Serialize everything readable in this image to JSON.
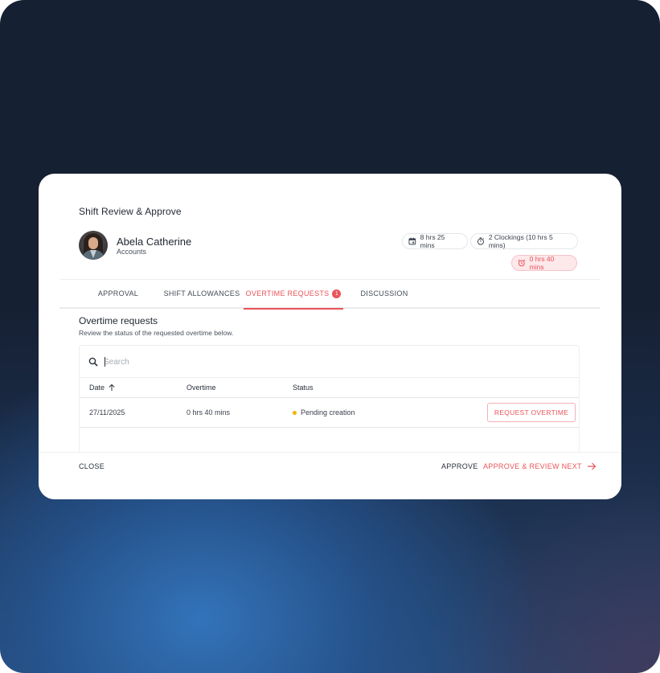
{
  "modal": {
    "title": "Shift Review & Approve"
  },
  "employee": {
    "name": "Abela Catherine",
    "department": "Accounts"
  },
  "stats": {
    "hours": "8 hrs 25 mins",
    "clockings": "2 Clockings (10 hrs 5 mins)",
    "overtime": "0 hrs 40 mins"
  },
  "tabs": [
    {
      "label": "APPROVAL"
    },
    {
      "label": "SHIFT ALLOWANCES"
    },
    {
      "label": "OVERTIME REQUESTS",
      "badge": "1",
      "active": true
    },
    {
      "label": "DISCUSSION"
    }
  ],
  "section": {
    "title": "Overtime requests",
    "subtitle": "Review the status of the requested overtime below."
  },
  "search": {
    "placeholder": "Search"
  },
  "table": {
    "columns": [
      "Date",
      "Overtime",
      "Status"
    ],
    "rows": [
      {
        "date": "27/11/2025",
        "overtime": "0 hrs 40 mins",
        "status": "Pending creation",
        "action": "REQUEST OVERTIME"
      }
    ]
  },
  "footer": {
    "close": "CLOSE",
    "approve": "APPROVE",
    "approve_next": "APPROVE & REVIEW NEXT"
  },
  "colors": {
    "accent": "#ea5459",
    "pending": "#f5b400",
    "overtime_chip_bg": "#fde8ea"
  }
}
